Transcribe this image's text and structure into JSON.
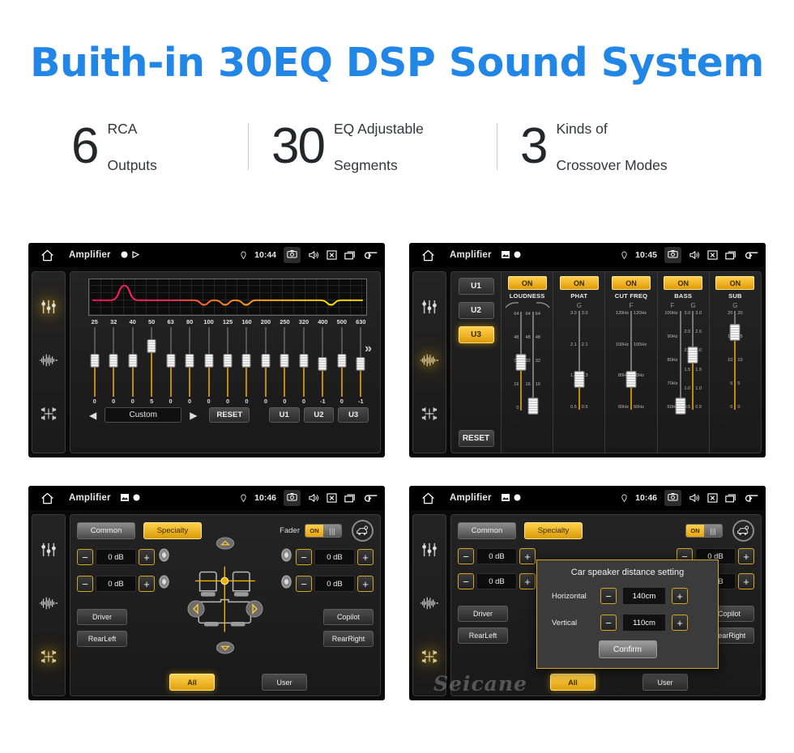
{
  "header": {
    "title": "Buith-in 30EQ DSP Sound System",
    "title_color": "#2186e6",
    "stats": [
      {
        "number": "6",
        "line1": "RCA",
        "line2": "Outputs"
      },
      {
        "number": "30",
        "line1": "EQ Adjustable",
        "line2": "Segments"
      },
      {
        "number": "3",
        "line1": "Kinds of",
        "line2": "Crossover Modes"
      }
    ]
  },
  "accent": {
    "amber": "#f5b400",
    "amber_dark": "#e09b0a",
    "blue": "#2186e6"
  },
  "watermark": "Seicane",
  "screens": {
    "eq": {
      "statusbar": {
        "app": "Amplifier",
        "time": "10:44"
      },
      "rail": [
        "equalizer-icon",
        "waveform-icon",
        "balance-icon"
      ],
      "rail_active": 0,
      "frequencies": [
        "25",
        "32",
        "40",
        "50",
        "63",
        "80",
        "100",
        "125",
        "160",
        "200",
        "250",
        "320",
        "400",
        "500",
        "630"
      ],
      "values": [
        0,
        0,
        0,
        5,
        0,
        0,
        0,
        0,
        0,
        0,
        0,
        0,
        -1,
        0,
        -1
      ],
      "preset": "Custom",
      "prev_label": "◀",
      "next_label": "▶",
      "more_label": "»",
      "buttons": {
        "reset": "RESET",
        "u1": "U1",
        "u2": "U2",
        "u3": "U3"
      }
    },
    "crossover": {
      "statusbar": {
        "app": "Amplifier",
        "time": "10:45"
      },
      "rail_active": 1,
      "presets": [
        {
          "label": "U1",
          "active": false
        },
        {
          "label": "U2",
          "active": false
        },
        {
          "label": "U3",
          "active": true
        }
      ],
      "reset_label": "RESET",
      "columns": [
        {
          "name": "LOUDNESS",
          "toggle": "ON",
          "headers": [
            "curve-up-icon",
            "curve-down-icon"
          ],
          "sliders": [
            {
              "ticks": [
                "64",
                "48",
                "32",
                "16",
                "0"
              ],
              "pos": 0.48,
              "filled": true
            },
            {
              "ticks": [
                "64",
                "48",
                "32",
                "16",
                "0"
              ],
              "pos": 0.04,
              "filled": false
            }
          ]
        },
        {
          "name": "PHAT",
          "toggle": "ON",
          "headers": [
            "G"
          ],
          "sliders": [
            {
              "ticks": [
                "3.0",
                "2.1",
                "1.3",
                "0.5"
              ],
              "pos": 0.3,
              "filled": true
            }
          ]
        },
        {
          "name": "CUT FREQ",
          "toggle": "ON",
          "headers": [
            "F"
          ],
          "sliders": [
            {
              "ticks": [
                "120Hz",
                "100Hz",
                "80Hz",
                "60Hz"
              ],
              "pos": 0.3,
              "filled": true
            }
          ]
        },
        {
          "name": "BASS",
          "toggle": "ON",
          "headers": [
            "F",
            "G"
          ],
          "sliders": [
            {
              "ticks": [
                "100Hz",
                "90Hz",
                "80Hz",
                "70Hz",
                "60Hz"
              ],
              "pos": 0.03,
              "filled": false
            },
            {
              "ticks": [
                "3.0",
                "2.5",
                "2.0",
                "1.5",
                "1.0",
                "0.5"
              ],
              "pos": 0.55,
              "filled": true
            }
          ]
        },
        {
          "name": "SUB",
          "toggle": "ON",
          "headers": [
            "G"
          ],
          "sliders": [
            {
              "ticks": [
                "20",
                "15",
                "10",
                "5",
                "0"
              ],
              "pos": 0.78,
              "filled": true
            }
          ]
        }
      ]
    },
    "fader": {
      "statusbar": {
        "app": "Amplifier",
        "time": "10:46"
      },
      "rail_active": 2,
      "tabs": [
        {
          "label": "Common",
          "active": false
        },
        {
          "label": "Specialty",
          "active": true
        }
      ],
      "fader_label": "Fader",
      "fader_toggle": "ON",
      "car_settings_icon": "car-settings-icon",
      "db_left": [
        "0 dB",
        "0 dB"
      ],
      "db_right": [
        "0 dB",
        "0 dB"
      ],
      "minus": "−",
      "plus": "+",
      "seat_buttons": {
        "driver": "Driver",
        "copilot": "Copilot",
        "rear_left": "RearLeft",
        "all": "All",
        "user": "User",
        "rear_right": "RearRight",
        "active": "All"
      },
      "pad_arrows": {
        "up": "△",
        "down": "▽",
        "left": "◁",
        "right": "▷"
      }
    },
    "dialog": {
      "statusbar": {
        "app": "Amplifier",
        "time": "10:46"
      },
      "rail_active": 2,
      "title": "Car speaker distance setting",
      "rows": [
        {
          "label": "Horizontal",
          "value": "140cm"
        },
        {
          "label": "Vertical",
          "value": "110cm"
        }
      ],
      "minus": "−",
      "plus": "+",
      "confirm": "Confirm"
    }
  }
}
